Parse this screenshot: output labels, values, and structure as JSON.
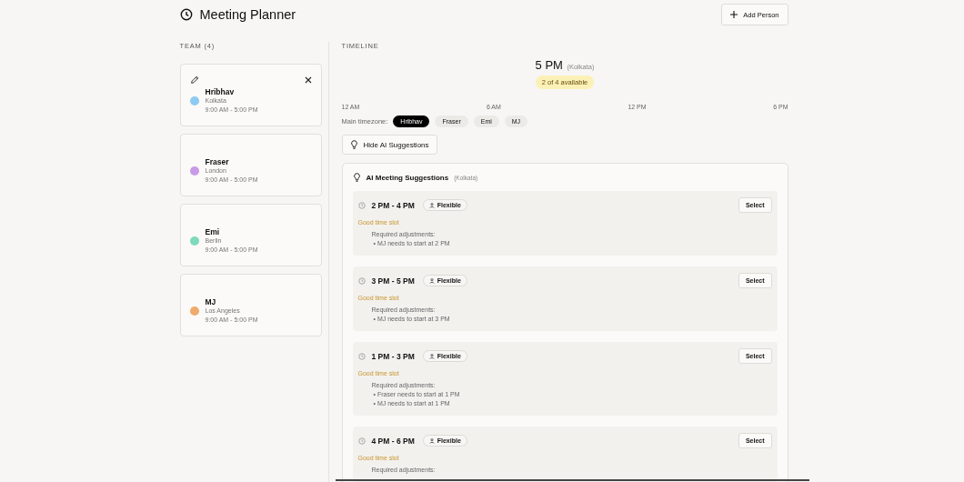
{
  "header": {
    "title": "Meeting Planner",
    "add_button": "Add Person"
  },
  "team": {
    "heading": "TEAM (4)",
    "members": [
      {
        "name": "Hribhav",
        "city": "Kolkata",
        "hours": "9:00 AM - 5:00 PM",
        "color": "#8ecbf0",
        "show_actions": true
      },
      {
        "name": "Fraser",
        "city": "London",
        "hours": "9:00 AM - 5:00 PM",
        "color": "#c99be6",
        "show_actions": false
      },
      {
        "name": "Emi",
        "city": "Berlin",
        "hours": "9:00 AM - 5:00 PM",
        "color": "#7fd9bd",
        "show_actions": false
      },
      {
        "name": "MJ",
        "city": "Los Angeles",
        "hours": "9:00 AM - 5:00 PM",
        "color": "#eeab6c",
        "show_actions": false
      }
    ]
  },
  "timeline": {
    "heading": "TIMELINE",
    "time": "5 PM",
    "zone": "(Kolkata)",
    "availability": "2 of 4 available",
    "ticks": [
      "12 AM",
      "6 AM",
      "12 PM",
      "6 PM"
    ],
    "main_timezone_label": "Main timezone:",
    "timezones": [
      {
        "label": "Hribhav",
        "selected": true
      },
      {
        "label": "Fraser",
        "selected": false
      },
      {
        "label": "Emi",
        "selected": false
      },
      {
        "label": "MJ",
        "selected": false
      }
    ],
    "toggle_button": "Hide AI Suggestions"
  },
  "suggestions": {
    "title": "AI Meeting Suggestions",
    "zone": "(Kolkata)",
    "items": [
      {
        "time": "2 PM - 4 PM",
        "tag": "Flexible",
        "quality": "Good time slot",
        "adjustments_label": "Required adjustments:",
        "adjustments": [
          "• MJ needs to start at 2 PM"
        ],
        "button": "Select"
      },
      {
        "time": "3 PM - 5 PM",
        "tag": "Flexible",
        "quality": "Good time slot",
        "adjustments_label": "Required adjustments:",
        "adjustments": [
          "• MJ needs to start at 3 PM"
        ],
        "button": "Select"
      },
      {
        "time": "1 PM - 3 PM",
        "tag": "Flexible",
        "quality": "Good time slot",
        "adjustments_label": "Required adjustments:",
        "adjustments": [
          "• Fraser needs to start at 1 PM",
          "• MJ needs to start at 1 PM"
        ],
        "button": "Select"
      },
      {
        "time": "4 PM - 6 PM",
        "tag": "Flexible",
        "quality": "Good time slot",
        "adjustments_label": "Required adjustments:",
        "button": "Select"
      }
    ]
  }
}
